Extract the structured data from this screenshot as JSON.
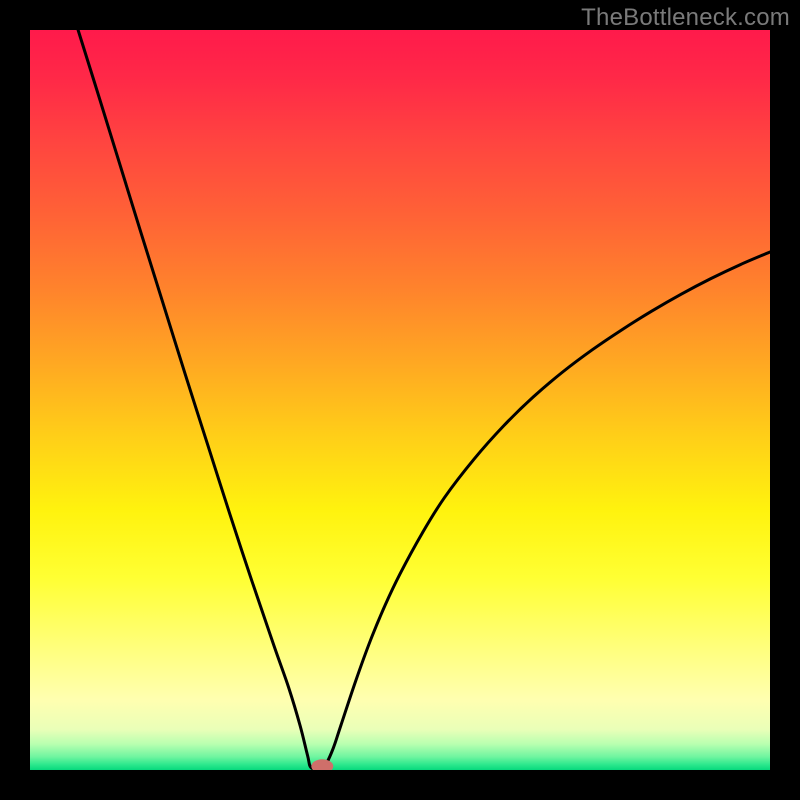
{
  "watermark": "TheBottleneck.com",
  "chart_data": {
    "type": "line",
    "title": "",
    "xlabel": "",
    "ylabel": "",
    "xlim": [
      0,
      100
    ],
    "ylim": [
      0,
      100
    ],
    "notch": {
      "x": 38,
      "y": 0
    },
    "marker": {
      "x": 39.5,
      "y": 0.5,
      "color": "#cf6f6a"
    },
    "left_curve": [
      {
        "x": 6.5,
        "y": 100
      },
      {
        "x": 9,
        "y": 92
      },
      {
        "x": 12,
        "y": 82.3
      },
      {
        "x": 15,
        "y": 72.6
      },
      {
        "x": 18,
        "y": 63
      },
      {
        "x": 21,
        "y": 53.4
      },
      {
        "x": 24,
        "y": 44
      },
      {
        "x": 27,
        "y": 34.6
      },
      {
        "x": 30,
        "y": 25.5
      },
      {
        "x": 33,
        "y": 16.7
      },
      {
        "x": 35,
        "y": 11
      },
      {
        "x": 36.5,
        "y": 6
      },
      {
        "x": 37.5,
        "y": 2
      },
      {
        "x": 38,
        "y": 0.3
      }
    ],
    "right_curve": [
      {
        "x": 38,
        "y": 0.3
      },
      {
        "x": 39.3,
        "y": 0.3
      },
      {
        "x": 40,
        "y": 0.8
      },
      {
        "x": 41,
        "y": 3
      },
      {
        "x": 42,
        "y": 6
      },
      {
        "x": 44,
        "y": 12
      },
      {
        "x": 46,
        "y": 17.5
      },
      {
        "x": 48,
        "y": 22.3
      },
      {
        "x": 50,
        "y": 26.5
      },
      {
        "x": 53,
        "y": 32
      },
      {
        "x": 56,
        "y": 36.8
      },
      {
        "x": 60,
        "y": 42
      },
      {
        "x": 64,
        "y": 46.5
      },
      {
        "x": 68,
        "y": 50.4
      },
      {
        "x": 72,
        "y": 53.8
      },
      {
        "x": 76,
        "y": 56.8
      },
      {
        "x": 80,
        "y": 59.5
      },
      {
        "x": 84,
        "y": 62
      },
      {
        "x": 88,
        "y": 64.3
      },
      {
        "x": 92,
        "y": 66.4
      },
      {
        "x": 96,
        "y": 68.3
      },
      {
        "x": 100,
        "y": 70
      }
    ],
    "gradient_stops": [
      {
        "offset": 0.0,
        "color": "#ff1a4b"
      },
      {
        "offset": 0.07,
        "color": "#ff2a47"
      },
      {
        "offset": 0.15,
        "color": "#ff4440"
      },
      {
        "offset": 0.25,
        "color": "#ff6236"
      },
      {
        "offset": 0.35,
        "color": "#ff832c"
      },
      {
        "offset": 0.45,
        "color": "#ffa822"
      },
      {
        "offset": 0.55,
        "color": "#ffcf18"
      },
      {
        "offset": 0.65,
        "color": "#fff30e"
      },
      {
        "offset": 0.74,
        "color": "#ffff33"
      },
      {
        "offset": 0.84,
        "color": "#ffff80"
      },
      {
        "offset": 0.905,
        "color": "#ffffb0"
      },
      {
        "offset": 0.945,
        "color": "#eaffb8"
      },
      {
        "offset": 0.965,
        "color": "#b8ffb0"
      },
      {
        "offset": 0.982,
        "color": "#70f5a0"
      },
      {
        "offset": 0.992,
        "color": "#30e98e"
      },
      {
        "offset": 1.0,
        "color": "#06d97d"
      }
    ]
  }
}
